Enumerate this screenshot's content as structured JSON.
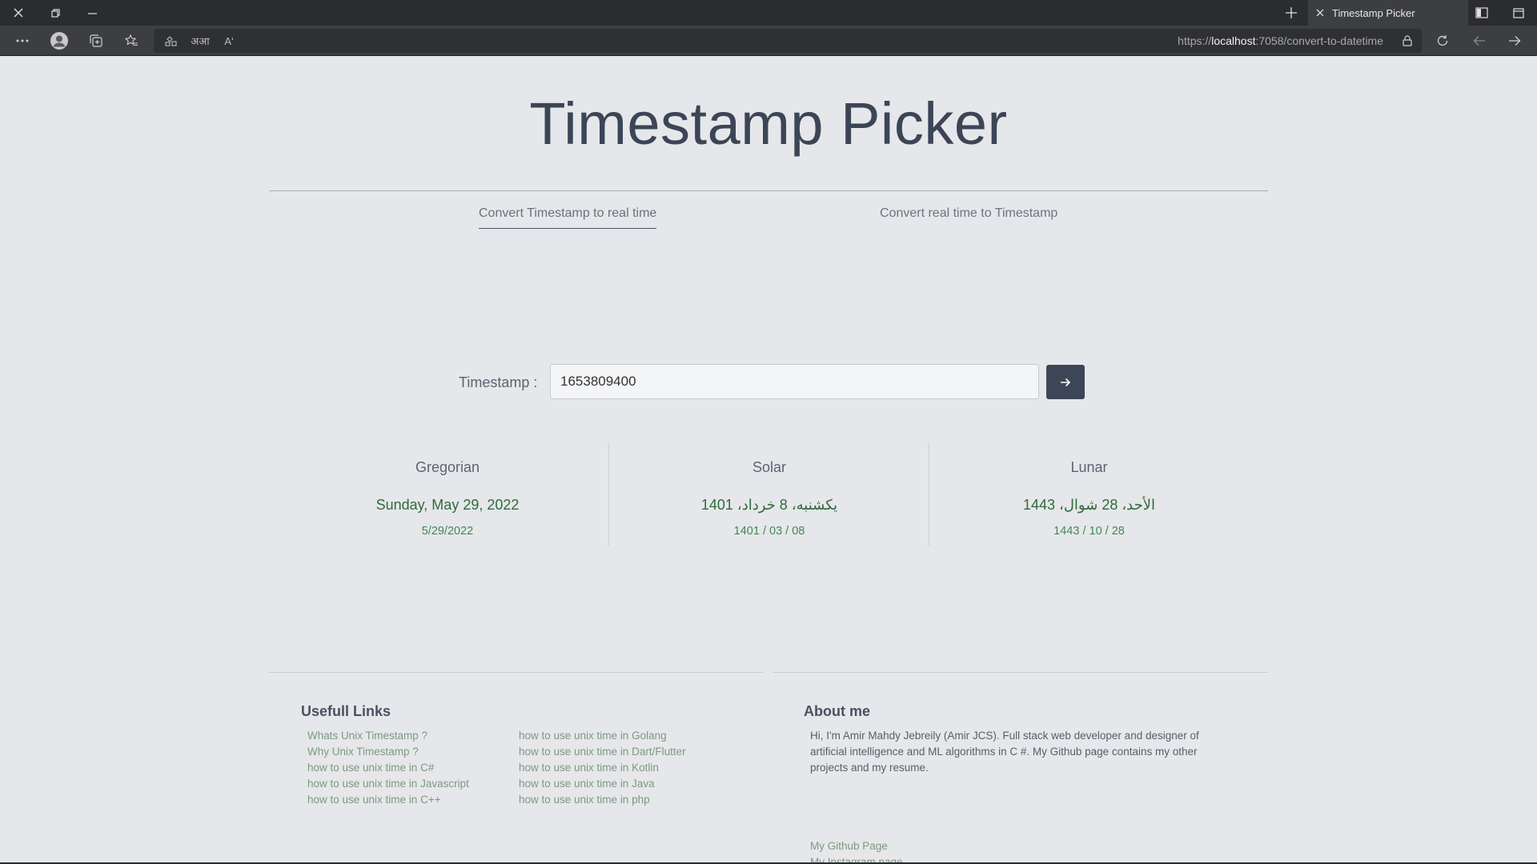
{
  "browser": {
    "tab_title": "Timestamp Picker",
    "url_prefix": "https://",
    "url_host": "localhost",
    "url_rest": ":7058/convert-to-datetime",
    "toolbar_icons": [
      "more-icon",
      "profile-icon",
      "collections-icon",
      "favorites-icon",
      "app-available-icon",
      "translate-icon",
      "read-aloud-icon"
    ],
    "read_aloud_glyph": "Aʹ",
    "translate_glyph": "अआ"
  },
  "page": {
    "title": "Timestamp Picker",
    "tabs": [
      {
        "label": "Convert Timestamp to real time",
        "active": true
      },
      {
        "label": "Convert real time to Timestamp",
        "active": false
      }
    ],
    "form": {
      "label": "Timestamp :",
      "value": "1653809400"
    },
    "results": [
      {
        "heading": "Gregorian",
        "long": "Sunday, May 29, 2022",
        "short": "5/29/2022"
      },
      {
        "heading": "Solar",
        "long": "یکشنبه، 8 خرداد، 1401",
        "short": "1401 / 03 / 08"
      },
      {
        "heading": "Lunar",
        "long": "الأحد، 28 شوال، 1443",
        "short": "1443 / 10 / 28"
      }
    ]
  },
  "footer": {
    "links_heading": "Usefull Links",
    "links_col1": [
      "Whats Unix Timestamp ?",
      "Why Unix Timestamp ?",
      "how to use unix time in C#",
      "how to use unix time in Javascript",
      "how to use unix time in C++"
    ],
    "links_col2": [
      "how to use unix time in Golang",
      "how to use unix time in Dart/Flutter",
      "how to use unix time in Kotlin",
      "how to use unix time in Java",
      "how to use unix time in php"
    ],
    "about_heading": "About me",
    "about_text": "Hi, I'm Amir Mahdy Jebreily (Amir JCS). Full stack web developer and designer of artificial intelligence and ML algorithms in C #. My Github page contains my other projects and my resume.",
    "about_links": [
      "My Github Page",
      "My Instagram page"
    ]
  }
}
